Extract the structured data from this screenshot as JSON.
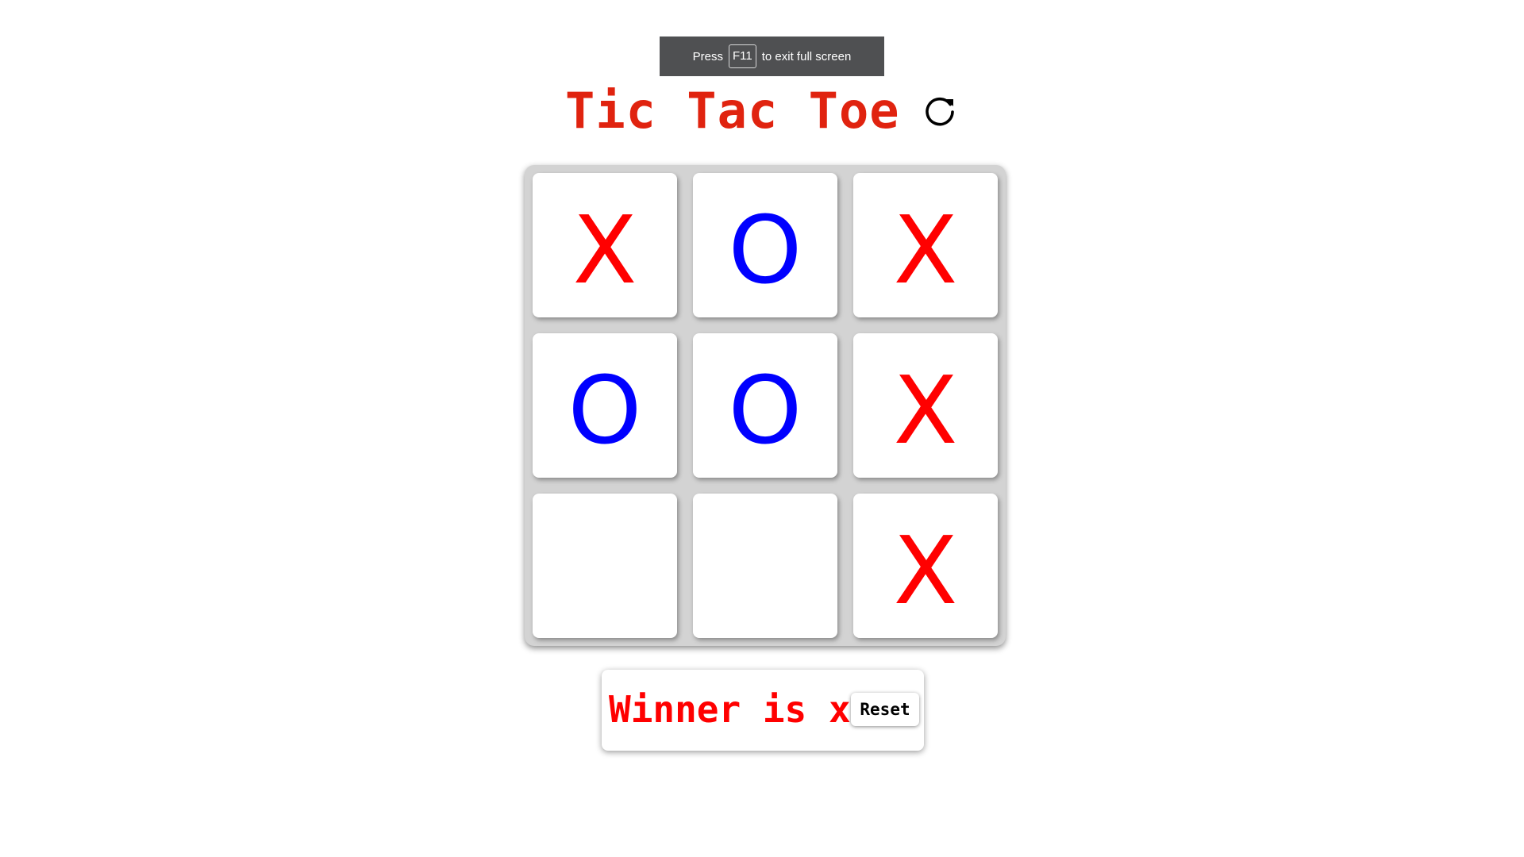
{
  "fullscreen_notice": {
    "prefix": "Press",
    "key": "F11",
    "suffix": "to exit full screen"
  },
  "header": {
    "title": "Tic Tac Toe",
    "reload_icon": "reload-icon"
  },
  "board": {
    "cells": [
      "X",
      "O",
      "X",
      "O",
      "O",
      "X",
      "",
      "",
      "X"
    ]
  },
  "status": {
    "winner_text": "Winner is x",
    "reset_label": "Reset"
  },
  "colors": {
    "title": "#e0230f",
    "x_mark": "#ff0000",
    "o_mark": "#0000ff",
    "winner_text": "#ff0000",
    "board_background": "#d3d3d3"
  }
}
